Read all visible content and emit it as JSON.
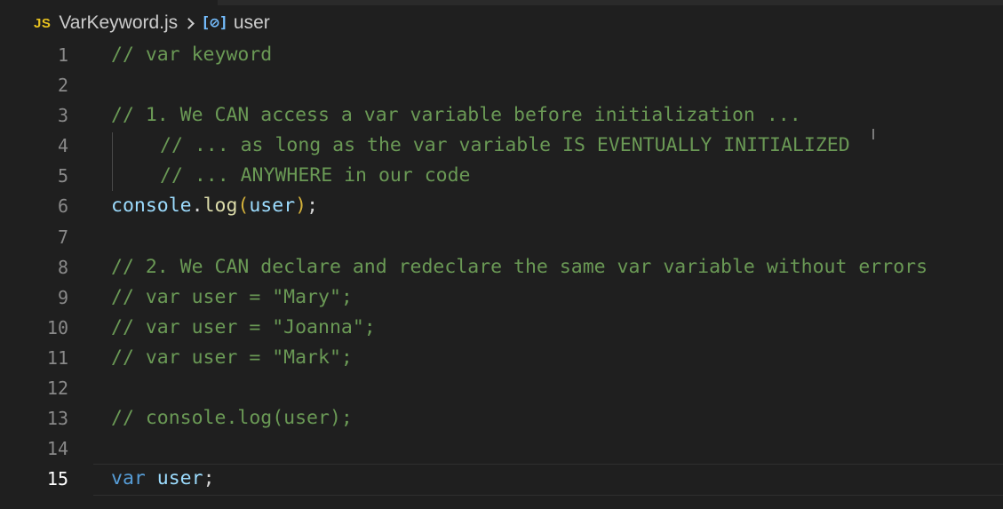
{
  "breadcrumb": {
    "badge": "JS",
    "file": "VarKeyword.js",
    "symbol_icon": "[⊘]",
    "symbol": "user"
  },
  "lines": [
    {
      "num": "1",
      "text": "// var keyword"
    },
    {
      "num": "2",
      "text": ""
    },
    {
      "num": "3",
      "text": "// 1. We CAN access a var variable before initialization ..."
    },
    {
      "num": "4",
      "text": "// ... as long as the var variable IS EVENTUALLY INITIALIZED"
    },
    {
      "num": "5",
      "text": "// ... ANYWHERE in our code"
    },
    {
      "num": "6",
      "parts": [
        "console",
        ".",
        "log",
        "(",
        "user",
        ")",
        ";"
      ]
    },
    {
      "num": "7",
      "text": ""
    },
    {
      "num": "8",
      "text": "// 2. We CAN declare and redeclare the same var variable without errors"
    },
    {
      "num": "9",
      "text": "// var user = \"Mary\";"
    },
    {
      "num": "10",
      "text": "// var user = \"Joanna\";"
    },
    {
      "num": "11",
      "text": "// var user = \"Mark\";"
    },
    {
      "num": "12",
      "text": ""
    },
    {
      "num": "13",
      "text": "// console.log(user);"
    },
    {
      "num": "14",
      "text": ""
    },
    {
      "num": "15",
      "parts": [
        "var",
        " ",
        "user",
        ";"
      ]
    }
  ],
  "icons": {
    "language": "javascript-file-icon",
    "breadcrumb_separator": "chevron-right-icon",
    "symbol": "variable-symbol-icon"
  },
  "colors": {
    "background": "#1f1f1f",
    "comment": "#6a9955",
    "keyword": "#569cd6",
    "identifier": "#9cdcfe",
    "function": "#dcdcaa",
    "line_number": "#8a8a8a",
    "active_line_number": "#ffffff",
    "js_badge": "#e8c21f"
  }
}
